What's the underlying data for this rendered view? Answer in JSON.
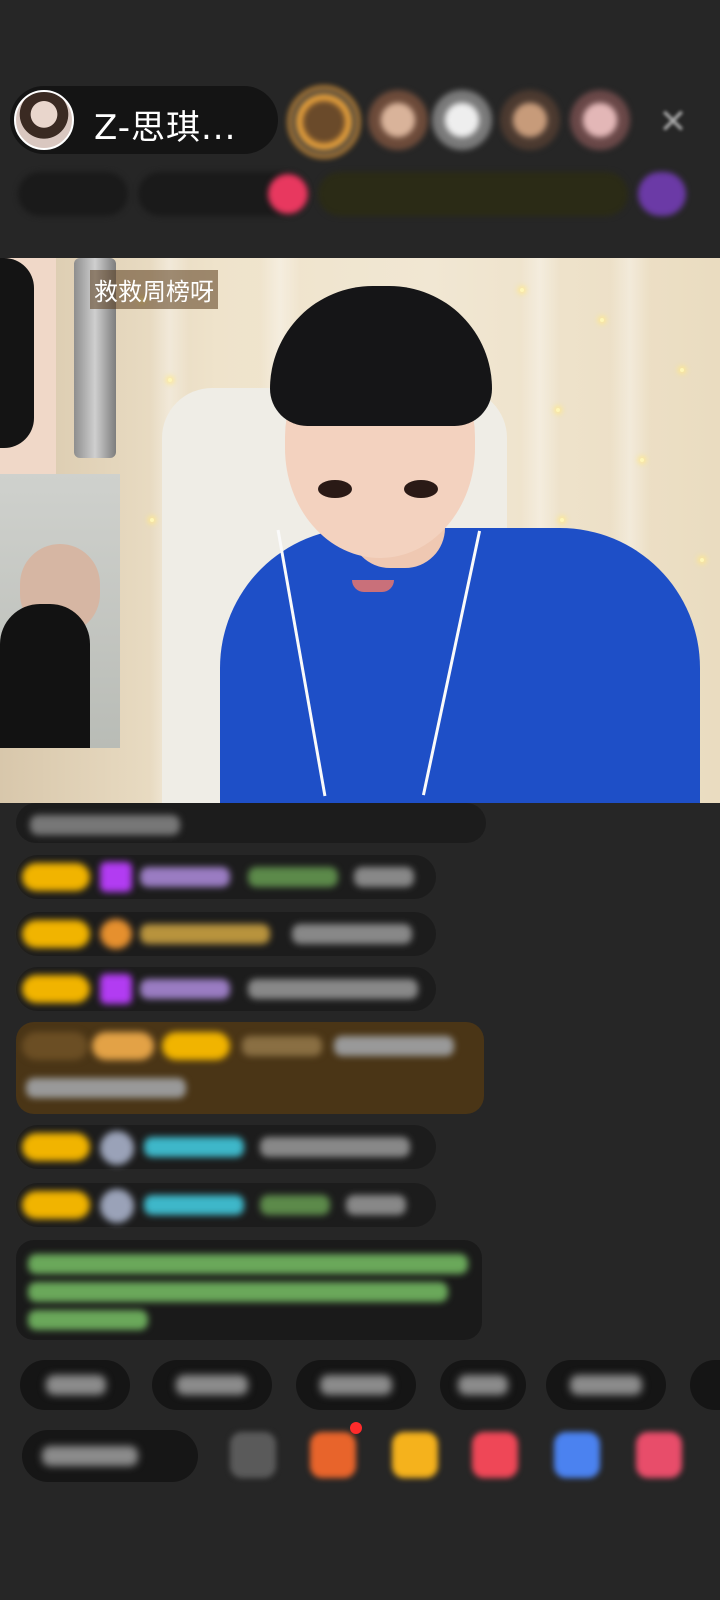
{
  "header": {
    "host_name": "Z-思琪...",
    "viewers": [
      "viewer-1",
      "viewer-2",
      "viewer-3",
      "viewer-4",
      "viewer-5"
    ],
    "close_icon": "close-icon"
  },
  "video": {
    "banner_text": "救救周榜呀"
  },
  "colors": {
    "background": "#262626",
    "badge_gold": "#f1b400",
    "gem_purple": "#b23cf2",
    "jacket_blue": "#1e4fc7",
    "chat_green": "#7ed36b",
    "name_teal": "#3eb7c9"
  },
  "chat": {
    "messages": [
      "msg-1",
      "msg-2",
      "msg-3",
      "msg-4",
      "msg-5",
      "msg-6",
      "msg-7",
      "msg-8"
    ]
  },
  "quick_replies": [
    "qr-1",
    "qr-2",
    "qr-3",
    "qr-4",
    "qr-5"
  ],
  "toolbar": {
    "tools": [
      "more-icon",
      "gift-box-icon",
      "gift-icon",
      "heart-icon",
      "game-icon",
      "grid-icon"
    ]
  }
}
